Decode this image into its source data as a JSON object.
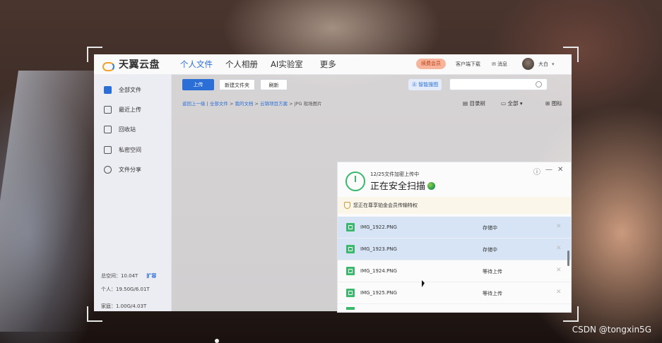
{
  "app": {
    "logo_text": "天翼云盘",
    "nav": [
      "个人文件",
      "个人相册",
      "AI实验室",
      "更多"
    ],
    "vip_button": "续费会员",
    "client_download": "客户端下载",
    "messages": "消息",
    "user_name": "大白"
  },
  "sidebar": {
    "items": [
      "全部文件",
      "最近上传",
      "回收站",
      "私密空间",
      "文件分享"
    ],
    "total_space": "总空间：10.04T",
    "expand": "扩容",
    "personal": "个人：19.50G/6.01T",
    "family": "家庭：1.00G/4.03T"
  },
  "toolbar": {
    "upload": "上传",
    "new_folder": "新建文件夹",
    "refresh": "刷新",
    "smart_search": "智能搜图"
  },
  "breadcrumb": {
    "back": "返回上一级",
    "sep": "|",
    "crumbs": [
      "全部文件",
      "我的文档",
      "云锦项目方案",
      "JPG 现场图片"
    ],
    "arrow": ">"
  },
  "view": {
    "tree": "目录树",
    "filter": "全部",
    "icons": "图标"
  },
  "upload_panel": {
    "progress_text": "12/25文件加密上传中",
    "title": "正在安全扫描",
    "banner": "您正在尊享铂金会员传输特权",
    "files": [
      {
        "name": "IMG_1922.PNG",
        "status": "存储中"
      },
      {
        "name": "IMG_1923.PNG",
        "status": "存储中"
      },
      {
        "name": "IMG_1924.PNG",
        "status": "等待上传"
      },
      {
        "name": "IMG_1925.PNG",
        "status": "等待上传"
      }
    ],
    "info_icon": "ⓘ",
    "minimize_icon": "—",
    "close_icon": "✕"
  },
  "watermark": "CSDN @tongxin5G",
  "colors": {
    "primary": "#2b6fd6",
    "vip": "#f7b49a",
    "success": "#3ab86b",
    "active_row": "#d2e1f5"
  }
}
